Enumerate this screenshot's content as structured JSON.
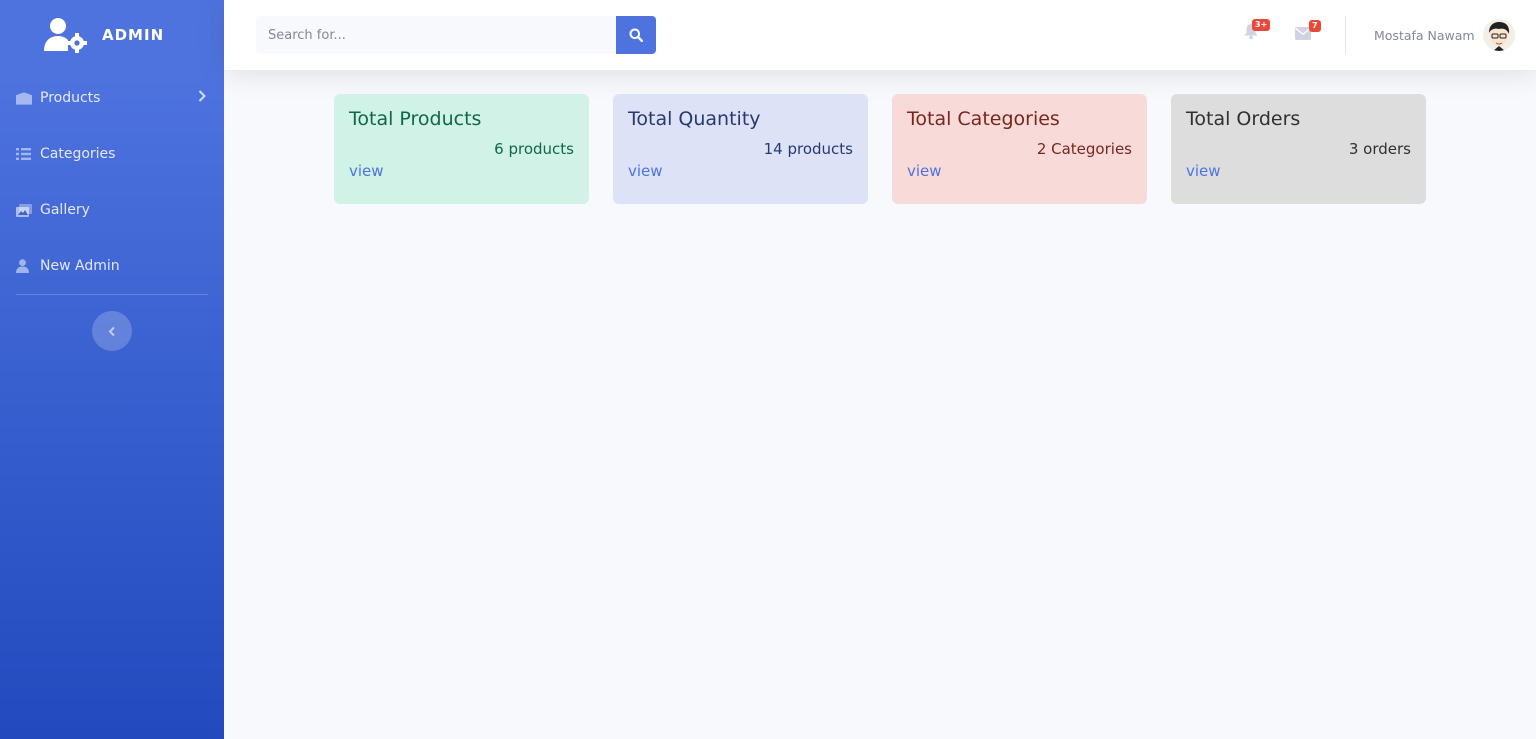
{
  "sidebar": {
    "brand": "ADMIN",
    "items": [
      {
        "label": "Products",
        "icon": "products-icon"
      },
      {
        "label": "Categories",
        "icon": "list-icon"
      },
      {
        "label": "Gallery",
        "icon": "images-icon"
      },
      {
        "label": "New Admin",
        "icon": "user-icon"
      }
    ]
  },
  "topbar": {
    "search_placeholder": "Search for...",
    "alerts_badge": "3+",
    "messages_badge": "7",
    "user_name": "Mostafa Nawam"
  },
  "cards": [
    {
      "title": "Total Products",
      "value": "6 products",
      "link": "view",
      "bg": "#d1f2e6",
      "color": "#0f6848"
    },
    {
      "title": "Total Quantity",
      "value": "14 products",
      "link": "view",
      "bg": "#dde2f7",
      "color": "#28396f"
    },
    {
      "title": "Total Categories",
      "value": "2 Categories",
      "link": "view",
      "bg": "#f8dbd8",
      "color": "#78261e"
    },
    {
      "title": "Total Orders",
      "value": "3 orders",
      "link": "view",
      "bg": "#dddddd",
      "color": "#303030"
    }
  ],
  "colors": {
    "primary": "#4e73df",
    "danger": "#e74a3b"
  }
}
